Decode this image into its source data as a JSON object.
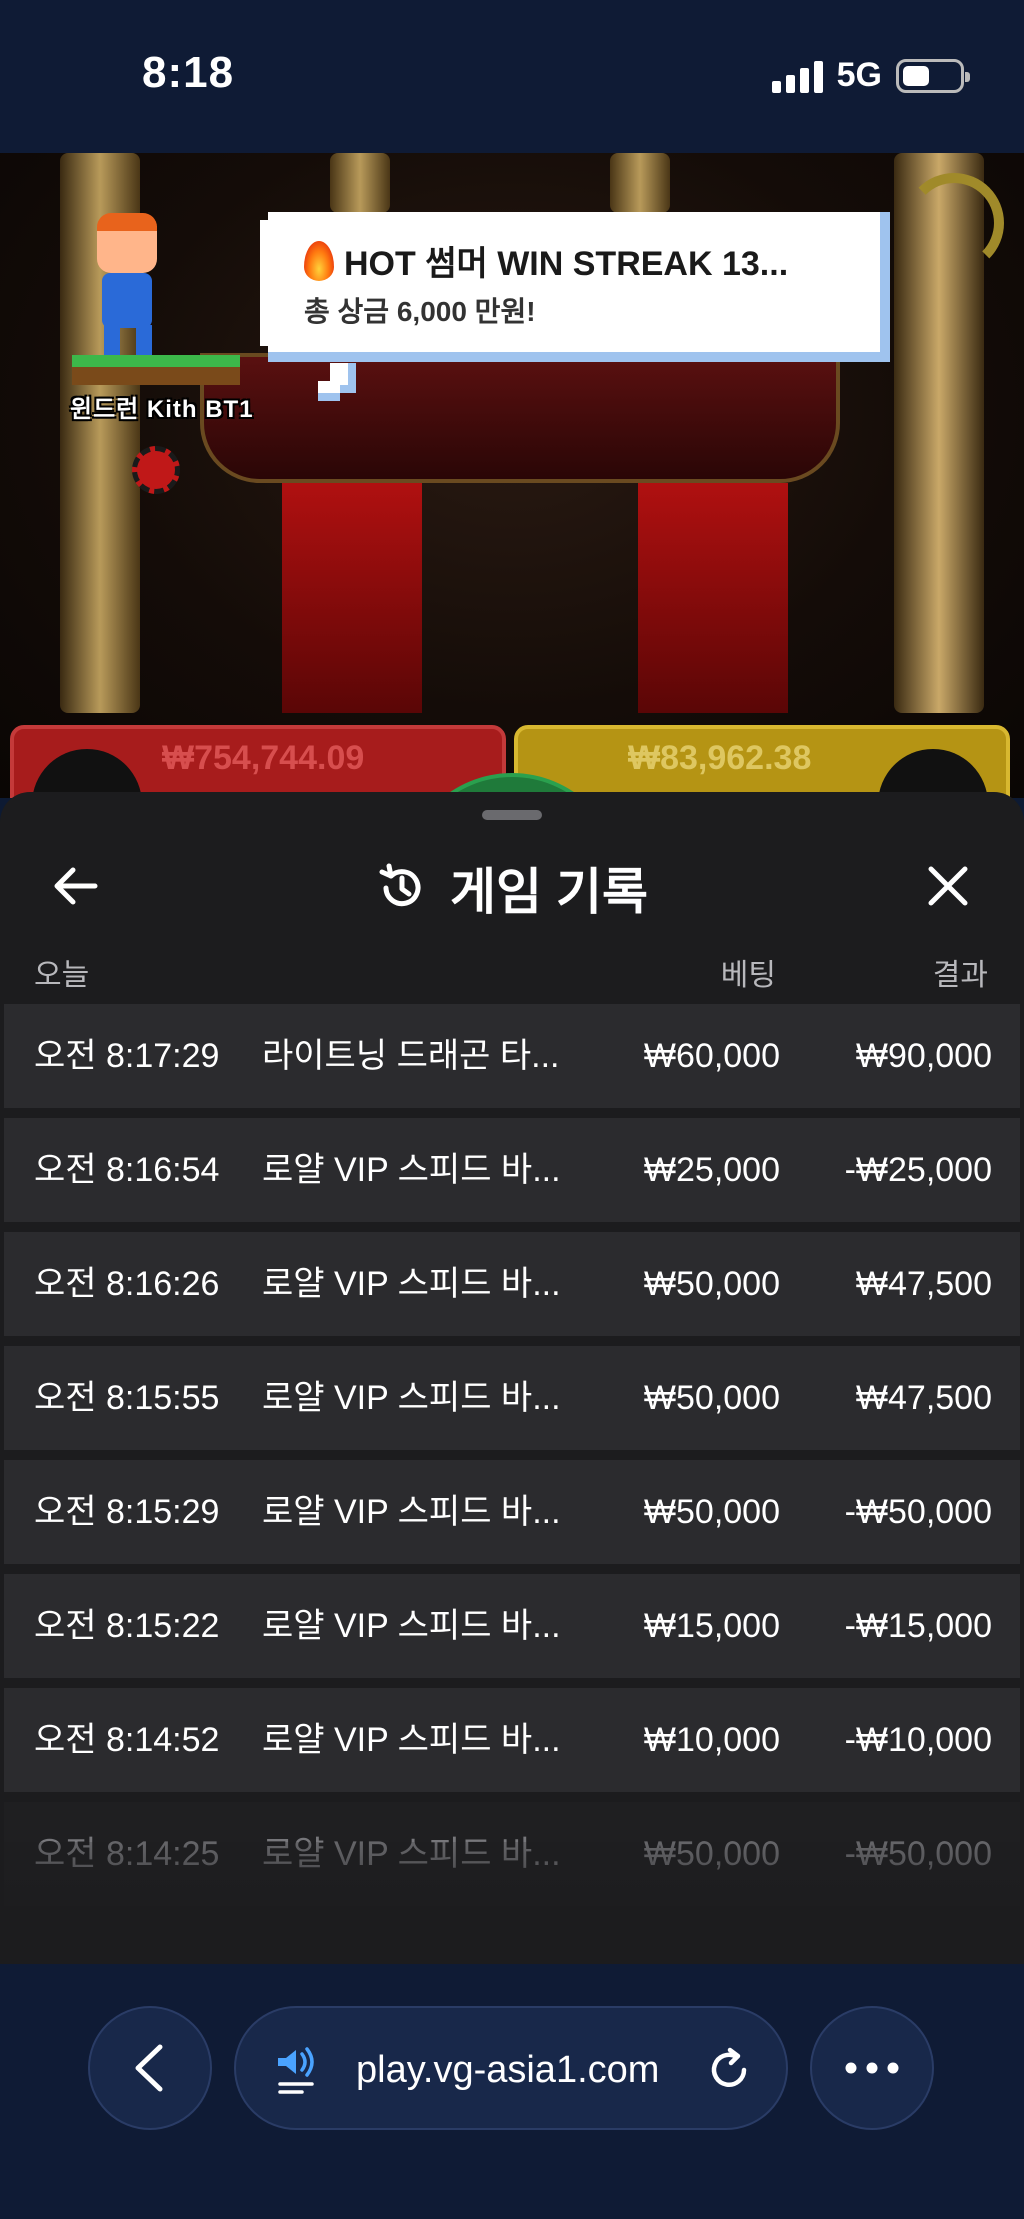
{
  "status_bar": {
    "time": "8:18",
    "network": "5G"
  },
  "game": {
    "mascot_label": "윈드런 Kith BT1",
    "banner_title": "HOT 썸머 WIN STREAK 13...",
    "banner_subtitle": "총 상금 6,000 만원!",
    "dragon_bet": "₩754,744.09",
    "tiger_bet": "₩83,962.38"
  },
  "sheet": {
    "title": "게임 기록",
    "col_today": "오늘",
    "col_bet": "베팅",
    "col_result": "결과",
    "rows": [
      {
        "time": "오전 8:17:29",
        "game": "라이트닝 드래곤 타...",
        "bet": "₩60,000",
        "result": "₩90,000"
      },
      {
        "time": "오전 8:16:54",
        "game": "로얄 VIP 스피드 바...",
        "bet": "₩25,000",
        "result": "-₩25,000"
      },
      {
        "time": "오전 8:16:26",
        "game": "로얄 VIP 스피드 바...",
        "bet": "₩50,000",
        "result": "₩47,500"
      },
      {
        "time": "오전 8:15:55",
        "game": "로얄 VIP 스피드 바...",
        "bet": "₩50,000",
        "result": "₩47,500"
      },
      {
        "time": "오전 8:15:29",
        "game": "로얄 VIP 스피드 바...",
        "bet": "₩50,000",
        "result": "-₩50,000"
      },
      {
        "time": "오전 8:15:22",
        "game": "로얄 VIP 스피드 바...",
        "bet": "₩15,000",
        "result": "-₩15,000"
      },
      {
        "time": "오전 8:14:52",
        "game": "로얄 VIP 스피드 바...",
        "bet": "₩10,000",
        "result": "-₩10,000"
      },
      {
        "time": "오전 8:14:25",
        "game": "로얄 VIP 스피드 바...",
        "bet": "₩50,000",
        "result": "-₩50,000"
      }
    ]
  },
  "browser": {
    "url": "play.vg-asia1.com"
  },
  "icons": {
    "back": "arrow-left-icon",
    "history": "history-icon",
    "close": "close-icon",
    "nav_back": "chevron-left-icon",
    "speaker": "speaker-icon",
    "reload": "reload-icon",
    "more": "more-icon",
    "fire": "fire-icon"
  },
  "colors": {
    "sheet_bg": "#1c1c1e",
    "row_bg": "#2b2b2e",
    "browser_bar": "#0f1b35",
    "accent_blue": "#4aa3ff"
  }
}
